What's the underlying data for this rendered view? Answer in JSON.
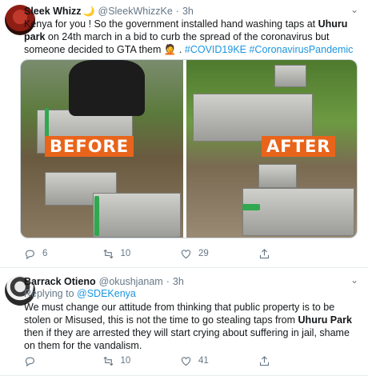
{
  "tweet1": {
    "name": "Sleek Whizz",
    "handle": "@SleekWhizzKe",
    "dot": "·",
    "time": "3h",
    "text_part1": "Kenya for you ! So the government installed  hand washing taps at ",
    "bold1": "Uhuru park",
    "text_part2": "  on 24th march  in a bid to curb the spread of the coronavirus but someone decided to GTA  them ",
    "text_part3": " . ",
    "hashtag1": "#COVID19KE",
    "hashtag2": "#CoronavirusPandemic",
    "image_labels": {
      "before": "BEFORE",
      "after": "AFTER"
    },
    "stats": {
      "replies": "6",
      "retweets": "10",
      "likes": "29"
    }
  },
  "tweet2": {
    "name": "Barrack Otieno",
    "handle": "@okushjanam",
    "dot": "·",
    "time": "3h",
    "replying_prefix": "Replying to ",
    "replying_to": "@SDEKenya",
    "text_part1": "We must change our attitude from thinking that public property is to be stolen or Misused, this is not the time to go stealing taps from ",
    "bold1": "Uhuru Park",
    "text_part2": " then if they are arrested they will start crying about suffering in jail, shame on them for the vandalism.",
    "stats": {
      "replies": "",
      "retweets": "10",
      "likes": "41"
    }
  },
  "icons": [
    "reply-icon",
    "retweet-icon",
    "like-icon",
    "share-icon",
    "caret-down-icon"
  ],
  "colors": {
    "link": "#1b95e0",
    "muted": "#657786",
    "stamp": "#e8641b"
  }
}
